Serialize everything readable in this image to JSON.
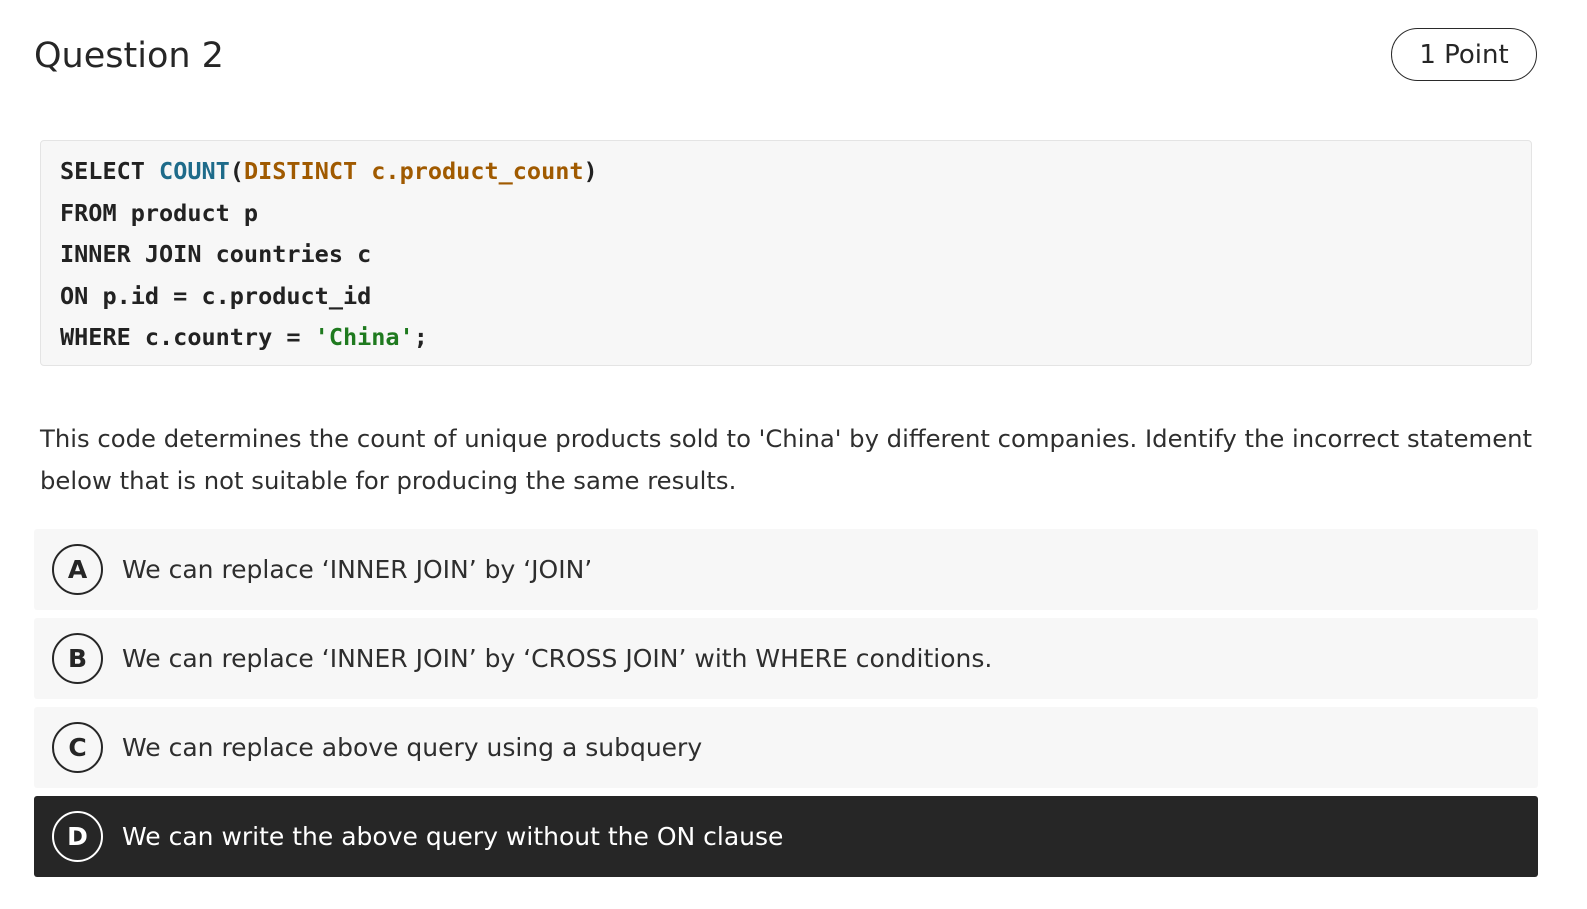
{
  "question": {
    "title": "Question 2",
    "points": "1 Point"
  },
  "code": {
    "lines": [
      [
        {
          "text": "SELECT ",
          "style": "plain"
        },
        {
          "text": "COUNT",
          "style": "fn"
        },
        {
          "text": "(",
          "style": "plain"
        },
        {
          "text": "DISTINCT c.product_count",
          "style": "kw"
        },
        {
          "text": ")",
          "style": "plain"
        }
      ],
      [
        {
          "text": "FROM product p",
          "style": "plain"
        }
      ],
      [
        {
          "text": "INNER JOIN countries c",
          "style": "plain"
        }
      ],
      [
        {
          "text": "ON p.id = c.product_id",
          "style": "plain"
        }
      ],
      [
        {
          "text": "WHERE c.country = ",
          "style": "plain"
        },
        {
          "text": "'China'",
          "style": "str"
        },
        {
          "text": ";",
          "style": "plain"
        }
      ]
    ]
  },
  "prompt": "This code determines the count of unique products sold to 'China' by different companies. Identify the incorrect statement below that is not suitable for producing the same results.",
  "options": [
    {
      "letter": "A",
      "text": "We can replace ‘INNER JOIN’ by ‘JOIN’",
      "selected": false
    },
    {
      "letter": "B",
      "text": "We can replace ‘INNER JOIN’ by ‘CROSS JOIN’ with WHERE conditions.",
      "selected": false
    },
    {
      "letter": "C",
      "text": "We can replace above query using a subquery",
      "selected": false
    },
    {
      "letter": "D",
      "text": "We can write the above query without the ON clause",
      "selected": true
    }
  ],
  "colors": {
    "selected_background": "#262626",
    "option_background": "#f7f7f7",
    "code_function": "#1e6b8a",
    "code_keyword": "#a05a00",
    "code_string": "#1f7a1f"
  }
}
